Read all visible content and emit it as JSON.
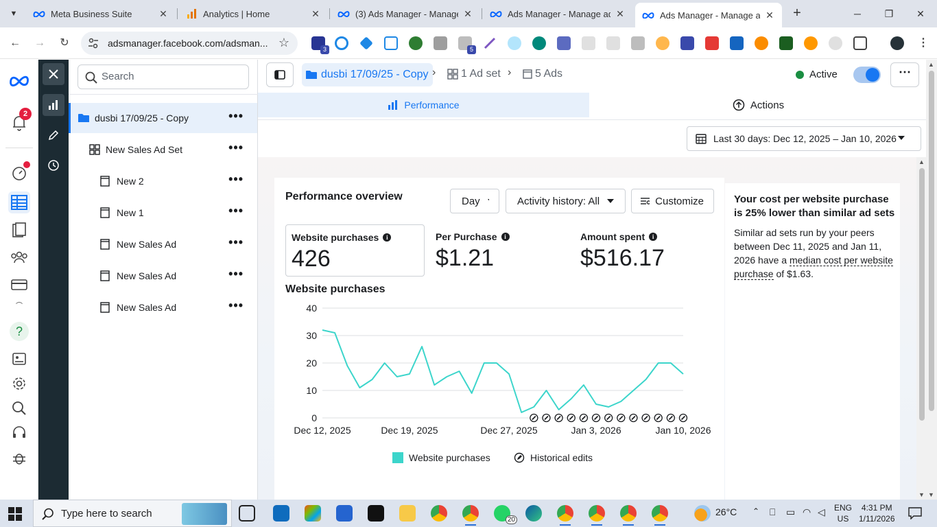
{
  "browser": {
    "tabs": [
      {
        "title": "Meta Business Suite",
        "active": false
      },
      {
        "title": "Analytics | Home",
        "active": false
      },
      {
        "title": "(3) Ads Manager - Manage a",
        "active": false
      },
      {
        "title": "Ads Manager - Manage ads",
        "active": false
      },
      {
        "title": "Ads Manager - Manage ads",
        "active": true
      }
    ],
    "url": "adsmanager.facebook.com/adsman...",
    "extension_badges": {
      "ext1": "3",
      "ext2": "5"
    }
  },
  "rail": {
    "notification_count": "2"
  },
  "tree": {
    "search_placeholder": "Search",
    "items": [
      {
        "label": "dusbi 17/09/25 - Copy",
        "type": "campaign"
      },
      {
        "label": "New Sales Ad Set",
        "type": "adset"
      },
      {
        "label": "New 2",
        "type": "ad"
      },
      {
        "label": "New 1",
        "type": "ad"
      },
      {
        "label": "New Sales Ad",
        "type": "ad"
      },
      {
        "label": "New Sales Ad",
        "type": "ad"
      },
      {
        "label": "New Sales Ad",
        "type": "ad"
      }
    ]
  },
  "header": {
    "campaign": "dusbi 17/09/25 - Copy",
    "adsets": "1 Ad set",
    "ads": "5 Ads",
    "status": "Active"
  },
  "tabs": {
    "performance": "Performance",
    "actions": "Actions"
  },
  "date_range": "Last 30 days: Dec 12, 2025 – Jan 10, 2026",
  "overview": {
    "title": "Performance overview",
    "granularity": "Day",
    "activity": "Activity history: All",
    "customize": "Customize",
    "metrics": [
      {
        "label": "Website purchases",
        "value": "426"
      },
      {
        "label": "Per Purchase",
        "value": "$1.21"
      },
      {
        "label": "Amount spent",
        "value": "$516.17"
      }
    ],
    "chart_title": "Website purchases",
    "legend": {
      "series": "Website purchases",
      "edits": "Historical edits"
    }
  },
  "chart_data": {
    "type": "line",
    "series": [
      {
        "name": "Website purchases",
        "color": "#3cd5cb",
        "values": [
          32,
          31,
          19,
          11,
          14,
          20,
          15,
          16,
          26,
          12,
          15,
          17,
          9,
          20,
          20,
          16,
          2,
          4,
          10,
          3,
          7,
          12,
          5,
          4,
          6,
          10,
          14,
          20,
          20,
          16
        ]
      }
    ],
    "x_start": "Dec 12, 2025",
    "x_end": "Jan 10, 2026",
    "x_tick_labels": [
      "Dec 12, 2025",
      "Dec 19, 2025",
      "Dec 27, 2025",
      "Jan 3, 2026",
      "Jan 10, 2026"
    ],
    "x_tick_days": [
      1,
      8,
      16,
      23,
      30
    ],
    "y_ticks": [
      0,
      10,
      20,
      30,
      40
    ],
    "ylim": [
      0,
      40
    ],
    "historical_edit_days": [
      18,
      19,
      20,
      21,
      22,
      23,
      24,
      25,
      26,
      27,
      28,
      29,
      30
    ],
    "grid": true
  },
  "insight": {
    "headline": "Your cost per website purchase is 25% lower than similar ad sets",
    "body_before": "Similar ad sets run by your peers between Dec 11, 2025 and Jan 11, 2026 have a ",
    "body_link": "median cost per website purchase",
    "body_after": " of $1.63."
  },
  "taskbar": {
    "search_placeholder": "Type here to search",
    "whatsapp_badge": "20",
    "weather": "26°C",
    "lang1": "ENG",
    "lang2": "US",
    "time": "4:31 PM",
    "date": "1/11/2026"
  }
}
